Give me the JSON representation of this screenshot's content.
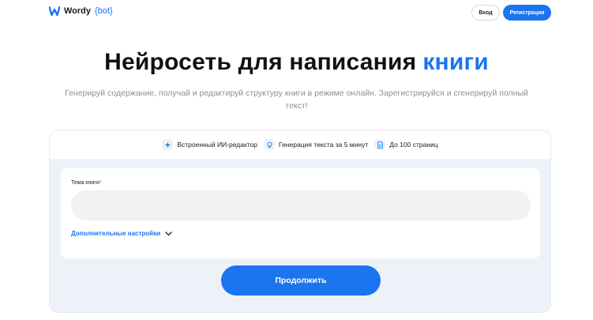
{
  "header": {
    "logo_word": "Wordy",
    "logo_bot": "{bot}",
    "login_label": "Вход",
    "register_label": "Регистрация"
  },
  "hero": {
    "title_main": "Нейросеть для написания",
    "title_accent": "книги",
    "subtitle": "Генерируй содержание, получай и редактируй структуру книги в режиме онлайн. Зарегистрируйся и сгенерируй полный текст!"
  },
  "features": [
    {
      "label": "Встроенный ИИ-редактор",
      "icon": "sparkle-icon"
    },
    {
      "label": "Генерация текста за 5 минут",
      "icon": "lightbulb-icon"
    },
    {
      "label": "До 100 страниц",
      "icon": "document-icon"
    }
  ],
  "form": {
    "field_label": "Тема книги",
    "required_mark": "*",
    "field_value": "",
    "advanced_label": "Дополнительные настройки",
    "continue_label": "Продолжить"
  },
  "colors": {
    "accent": "#1b74f0",
    "panel": "#edf2f9",
    "required": "#e53935"
  }
}
